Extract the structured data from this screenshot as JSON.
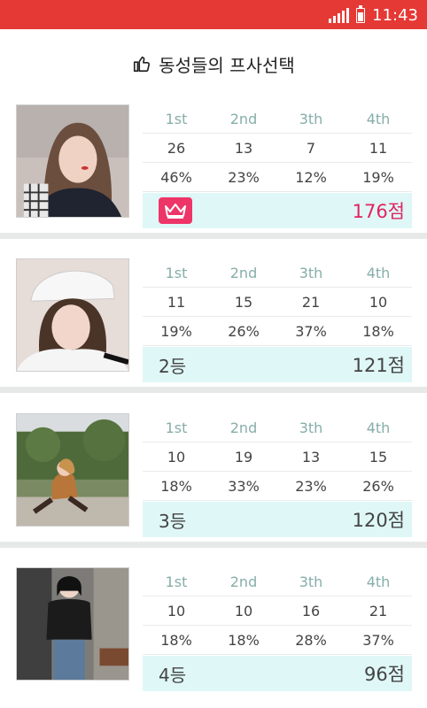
{
  "status_bar": {
    "time": "11:43",
    "signal_icon": "signal-icon",
    "battery_icon": "battery-icon"
  },
  "title": {
    "icon": "thumbs-up-icon",
    "text": "동성들의 프사선택"
  },
  "columns": [
    "1st",
    "2nd",
    "3th",
    "4th"
  ],
  "cards": [
    {
      "counts": [
        "26",
        "13",
        "7",
        "11"
      ],
      "percents": [
        "46%",
        "23%",
        "12%",
        "19%"
      ],
      "rank": "",
      "rank_icon": "crown-icon",
      "score": "176점"
    },
    {
      "counts": [
        "11",
        "15",
        "21",
        "10"
      ],
      "percents": [
        "19%",
        "26%",
        "37%",
        "18%"
      ],
      "rank": "2등",
      "score": "121점"
    },
    {
      "counts": [
        "10",
        "19",
        "13",
        "15"
      ],
      "percents": [
        "18%",
        "33%",
        "23%",
        "26%"
      ],
      "rank": "3등",
      "score": "120점"
    },
    {
      "counts": [
        "10",
        "10",
        "16",
        "21"
      ],
      "percents": [
        "18%",
        "18%",
        "28%",
        "37%"
      ],
      "rank": "4등",
      "score": "96점"
    }
  ],
  "colors": {
    "status_bar": "#e53935",
    "accent": "#e0245e",
    "result_bg": "#dff7f7",
    "header_text": "#86aea8"
  }
}
